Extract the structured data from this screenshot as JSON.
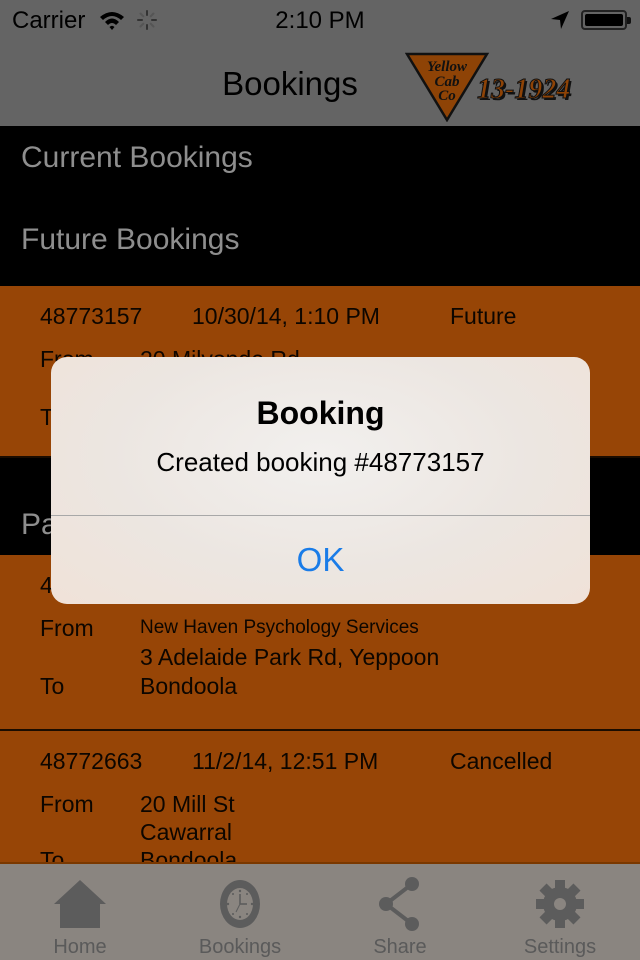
{
  "status_bar": {
    "carrier": "Carrier",
    "time": "2:10 PM",
    "icons": [
      "wifi-icon",
      "activity-spinner-icon",
      "location-arrow-icon",
      "battery-icon"
    ]
  },
  "nav": {
    "title": "Bookings",
    "logo": {
      "brand_lines": [
        "Yellow",
        "Cab",
        "Co"
      ],
      "phone": "13-1924"
    }
  },
  "sections": {
    "current": "Current Bookings",
    "future": "Future Bookings",
    "past": "Past Bookings"
  },
  "labels": {
    "from": "From",
    "to": "To"
  },
  "future_bookings": [
    {
      "number": "48773157",
      "datetime": "10/30/14, 1:10 PM",
      "status": "Future",
      "from": "20 Milvonde Rd",
      "to": ""
    }
  ],
  "past_bookings": [
    {
      "number": "4",
      "datetime": "",
      "status": "",
      "from_name": "New Haven Psychology Services",
      "from": "3 Adelaide Park Rd, Yeppoon",
      "to": "Bondoola"
    },
    {
      "number": "48772663",
      "datetime": "11/2/14, 12:51 PM",
      "status": "Cancelled",
      "from": "20 Mill St",
      "from_line2": "Cawarral",
      "to": "Bondoola"
    }
  ],
  "tabs": [
    {
      "label": "Home",
      "icon": "home-icon"
    },
    {
      "label": "Bookings",
      "icon": "clock-icon"
    },
    {
      "label": "Share",
      "icon": "share-icon"
    },
    {
      "label": "Settings",
      "icon": "gear-icon"
    }
  ],
  "alert": {
    "title": "Booking",
    "message": "Created booking #48773157",
    "ok_label": "OK"
  },
  "colors": {
    "row_orange": "#974506",
    "alert_button_blue": "#1a7ce8",
    "section_text": "#8e8e8e"
  }
}
